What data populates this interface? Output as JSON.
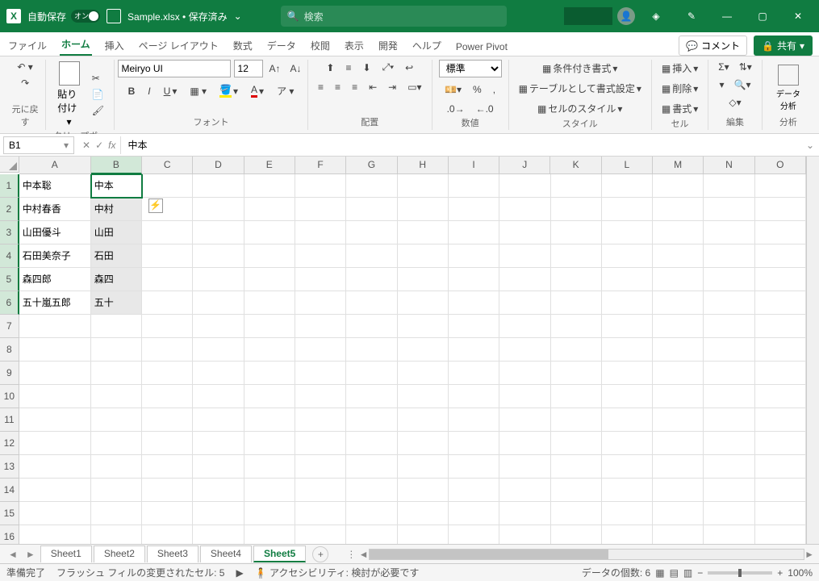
{
  "titlebar": {
    "autosave_label": "自動保存",
    "autosave_state": "オン",
    "filename": "Sample.xlsx • 保存済み",
    "search_placeholder": "検索"
  },
  "tabs": {
    "items": [
      "ファイル",
      "ホーム",
      "挿入",
      "ページ レイアウト",
      "数式",
      "データ",
      "校閲",
      "表示",
      "開発",
      "ヘルプ",
      "Power Pivot"
    ],
    "active": 1,
    "comments": "コメント",
    "share": "共有"
  },
  "ribbon": {
    "undo_group": "元に戻す",
    "clipboard_group": "クリップボード",
    "paste": "貼り付け",
    "font_group": "フォント",
    "font_name": "Meiryo UI",
    "font_size": "12",
    "align_group": "配置",
    "number_group": "数値",
    "number_format": "標準",
    "styles_group": "スタイル",
    "cond_format": "条件付き書式",
    "table_format": "テーブルとして書式設定",
    "cell_styles": "セルのスタイル",
    "cells_group": "セル",
    "insert": "挿入",
    "delete": "削除",
    "format": "書式",
    "editing_group": "編集",
    "analysis_group": "分析",
    "data_analysis": "データ分析"
  },
  "formula_bar": {
    "name_box": "B1",
    "formula": "中本"
  },
  "columns": [
    "A",
    "B",
    "C",
    "D",
    "E",
    "F",
    "G",
    "H",
    "I",
    "J",
    "K",
    "L",
    "M",
    "N",
    "O"
  ],
  "row_headers": [
    1,
    2,
    3,
    4,
    5,
    6,
    7,
    8,
    9,
    10,
    11,
    12,
    13,
    14,
    15,
    16
  ],
  "cells": {
    "A": [
      "中本聡",
      "中村春香",
      "山田優斗",
      "石田美奈子",
      "森四郎",
      "五十嵐五郎"
    ],
    "B": [
      "中本",
      "中村",
      "山田",
      "石田",
      "森四",
      "五十"
    ]
  },
  "selection": {
    "active": "B1",
    "range": "B1:B6"
  },
  "sheets": {
    "items": [
      "Sheet1",
      "Sheet2",
      "Sheet3",
      "Sheet4",
      "Sheet5"
    ],
    "active": 4
  },
  "statusbar": {
    "ready": "準備完了",
    "flash": "フラッシュ フィルの変更されたセル: 5",
    "accessibility": "アクセシビリティ: 検討が必要です",
    "count": "データの個数: 6",
    "zoom": "100%"
  }
}
